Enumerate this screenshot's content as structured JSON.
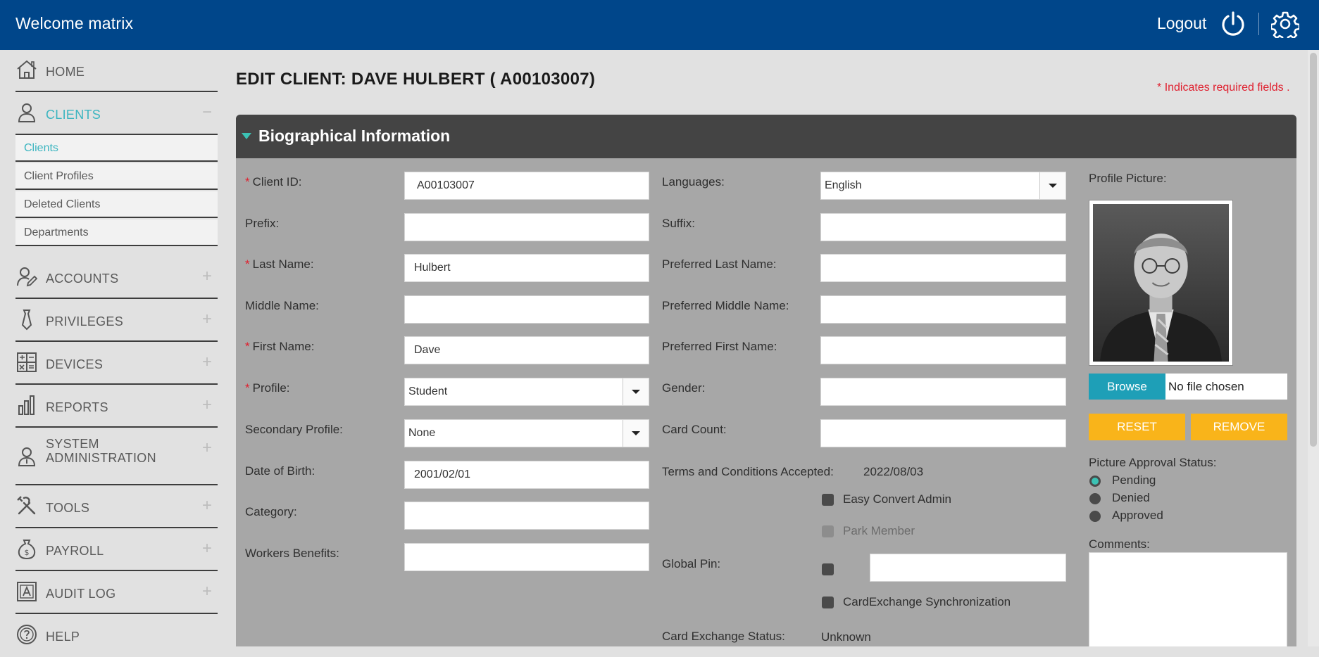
{
  "header": {
    "welcome": "Welcome matrix",
    "logout_label": "Logout",
    "power_icon": "power-icon",
    "settings_icon": "gear-icon",
    "bg_color": "#00468a"
  },
  "sidebar": {
    "items": [
      {
        "label": "HOME",
        "icon": "home-icon",
        "toggle": ""
      },
      {
        "label": "CLIENTS",
        "icon": "user-icon",
        "toggle": "−"
      },
      {
        "label": "ACCOUNTS",
        "icon": "user-edit-icon",
        "toggle": "+"
      },
      {
        "label": "PRIVILEGES",
        "icon": "tie-icon",
        "toggle": "+"
      },
      {
        "label": "DEVICES",
        "icon": "calculator-icon",
        "toggle": "+"
      },
      {
        "label": "REPORTS",
        "icon": "bar-chart-icon",
        "toggle": "+"
      },
      {
        "label": "SYSTEM ADMINISTRATION",
        "label_line1": "SYSTEM",
        "label_line2": "ADMINISTRATION",
        "icon": "admin-user-icon",
        "toggle": "+"
      },
      {
        "label": "TOOLS",
        "icon": "tools-icon",
        "toggle": "+"
      },
      {
        "label": "PAYROLL",
        "icon": "money-bag-icon",
        "toggle": "+"
      },
      {
        "label": "AUDIT LOG",
        "icon": "audit-log-icon",
        "toggle": "+"
      },
      {
        "label": "HELP",
        "icon": "help-icon",
        "toggle": ""
      }
    ],
    "clients_sub": [
      "Clients",
      "Client Profiles",
      "Deleted Clients",
      "Departments"
    ],
    "accent_color": "#3bb5c0"
  },
  "page": {
    "title": "EDIT CLIENT: DAVE HULBERT ( A00103007)",
    "required_note": "Indicates required fields .",
    "required_star": "*"
  },
  "section": {
    "title": "Biographical Information"
  },
  "left_form": {
    "client_id": {
      "label": "Client ID:",
      "value": "A00103007"
    },
    "prefix": {
      "label": "Prefix:",
      "value": ""
    },
    "last_name": {
      "label": "Last Name:",
      "value": "Hulbert"
    },
    "middle_name": {
      "label": "Middle Name:",
      "value": ""
    },
    "first_name": {
      "label": "First Name:",
      "value": "Dave"
    },
    "profile": {
      "label": "Profile:",
      "value": "Student"
    },
    "secondary_profile": {
      "label": "Secondary Profile:",
      "value": "None"
    },
    "dob": {
      "label": "Date of Birth:",
      "value": "2001/02/01"
    },
    "category": {
      "label": "Category:",
      "value": ""
    },
    "workers_benefits": {
      "label": "Workers Benefits:",
      "value": ""
    }
  },
  "right_form": {
    "languages": {
      "label": "Languages:",
      "value": "English"
    },
    "suffix": {
      "label": "Suffix:",
      "value": ""
    },
    "pref_last": {
      "label": "Preferred Last Name:",
      "value": ""
    },
    "pref_middle": {
      "label": "Preferred Middle Name:",
      "value": ""
    },
    "pref_first": {
      "label": "Preferred First Name:",
      "value": ""
    },
    "gender": {
      "label": "Gender:",
      "value": ""
    },
    "card_count": {
      "label": "Card Count:",
      "value": ""
    },
    "terms": {
      "label": "Terms and Conditions Accepted:",
      "value": "2022/08/03"
    },
    "easy_convert": {
      "label": "Easy Convert Admin",
      "checked": false
    },
    "park_member": {
      "label": "Park Member",
      "checked": false,
      "disabled": true
    },
    "global_pin": {
      "label": "Global Pin:",
      "checked": false,
      "value": ""
    },
    "card_exchange_sync": {
      "label": "CardExchange Synchronization",
      "checked": false
    },
    "card_exchange_status": {
      "label": "Card Exchange Status:",
      "value": "Unknown"
    }
  },
  "picture": {
    "label": "Profile Picture:",
    "browse_label": "Browse",
    "file_name": "No file chosen",
    "reset_label": "RESET",
    "remove_label": "REMOVE",
    "approval_label": "Picture Approval Status:",
    "approval_options": [
      "Pending",
      "Denied",
      "Approved"
    ],
    "approval_selected": "Pending",
    "comments_label": "Comments:",
    "comments_value": ""
  }
}
